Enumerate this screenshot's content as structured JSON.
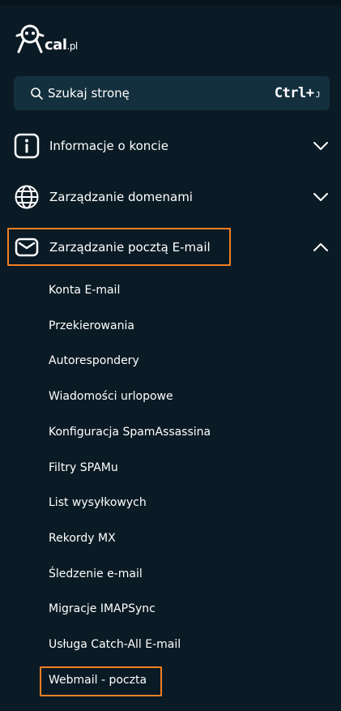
{
  "logo": {
    "text": "cal",
    "suffix": ".pl"
  },
  "search": {
    "label": "Szukaj stronę",
    "shortcut": "Ctrl+",
    "shortcut_key": "J"
  },
  "sections": [
    {
      "label": "Informacje o koncie",
      "icon": "info-icon",
      "state": "collapsed"
    },
    {
      "label": "Zarządzanie domenami",
      "icon": "globe-icon",
      "state": "collapsed"
    },
    {
      "label": "Zarządzanie pocztą E-mail",
      "icon": "mail-icon",
      "state": "expanded"
    }
  ],
  "email_items": [
    "Konta E-mail",
    "Przekierowania",
    "Autorespondery",
    "Wiadomości urlopowe",
    "Konfiguracja SpamAssassina",
    "Filtry SPAMu",
    "List wysyłkowych",
    "Rekordy MX",
    "Śledzenie e-mail",
    "Migracje IMAPSync",
    "Usługa Catch-All E-mail",
    "Webmail - poczta"
  ],
  "colors": {
    "background": "#0b1b25",
    "search_bg": "#14303f",
    "highlight": "#f07f23",
    "text": "#ffffff"
  }
}
